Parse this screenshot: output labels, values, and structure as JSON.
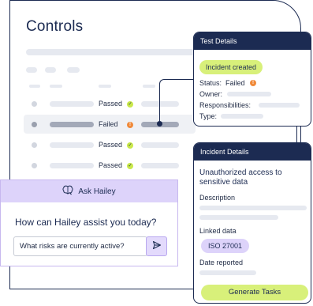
{
  "main": {
    "title": "Controls",
    "rows": [
      {
        "status": "Passed"
      },
      {
        "status": "Failed"
      },
      {
        "status": "Passed"
      },
      {
        "status": "Passed"
      }
    ],
    "badge_check": "✓",
    "badge_alert": "!"
  },
  "chat": {
    "header": "Ask Hailey",
    "question": "How can Hailey assist you today?",
    "input_value": "What risks are currently active?"
  },
  "test_details": {
    "header": "Test Details",
    "status_pill": "Incident created",
    "status_label": "Status:",
    "status_value": "Failed",
    "owner_label": "Owner:",
    "responsibilities_label": "Responsibilities:",
    "type_label": "Type:"
  },
  "incident_details": {
    "header": "Incident Details",
    "title": "Unauthorized access to sensitive data",
    "description_label": "Description",
    "linked_label": "Linked data",
    "linked_value": "ISO 27001",
    "date_label": "Date reported",
    "action_label": "Generate Tasks"
  },
  "colors": {
    "navy": "#1c2b52",
    "lime": "#d8f07a",
    "lavender": "#ddd3fa",
    "alert_orange": "#f08a3a"
  }
}
